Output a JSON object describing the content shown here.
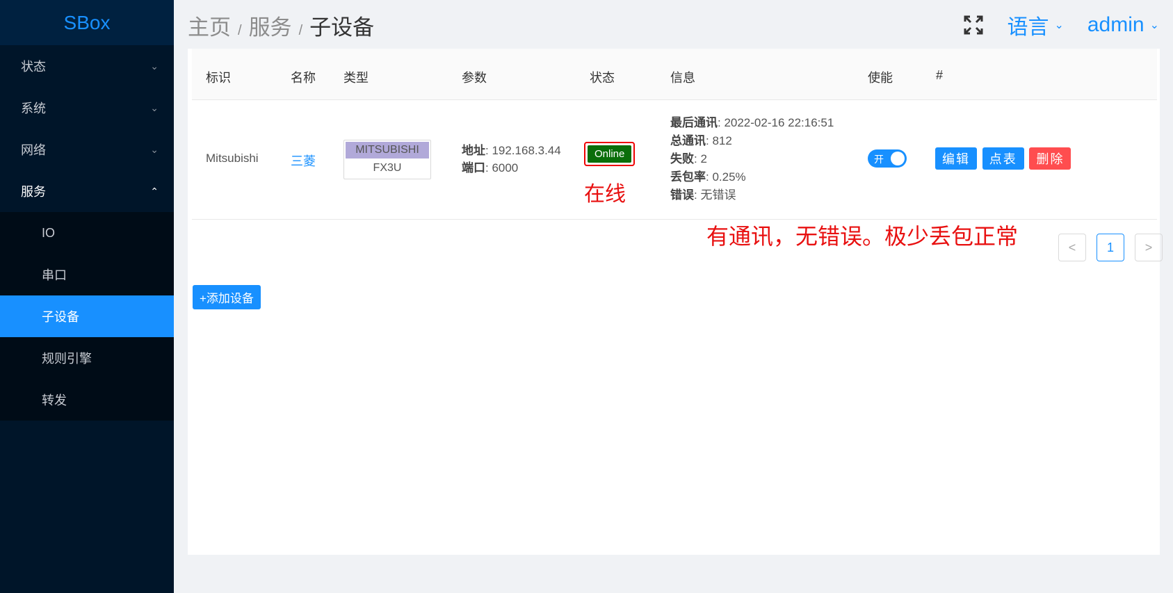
{
  "app": {
    "logo": "SBox"
  },
  "sidebar": {
    "items": [
      {
        "label": "状态"
      },
      {
        "label": "系统"
      },
      {
        "label": "网络"
      },
      {
        "label": "服务"
      }
    ],
    "sub_items": [
      {
        "label": "IO"
      },
      {
        "label": "串口"
      },
      {
        "label": "子设备"
      },
      {
        "label": "规则引擎"
      },
      {
        "label": "转发"
      }
    ],
    "active_item": "子设备"
  },
  "header": {
    "breadcrumb": [
      "主页",
      "服务",
      "子设备"
    ],
    "separator": "/",
    "language_label": "语言",
    "user_label": "admin"
  },
  "table": {
    "columns": [
      "标识",
      "名称",
      "类型",
      "参数",
      "状态",
      "信息",
      "使能",
      "#"
    ],
    "rows": [
      {
        "id": "Mitsubishi",
        "name": "三菱",
        "type_top": "MITSUBISHI",
        "type_bottom": "FX3U",
        "params": [
          {
            "label": "地址",
            "value": ": 192.168.3.44"
          },
          {
            "label": "端口",
            "value": ": 6000"
          }
        ],
        "status": "Online",
        "info": [
          {
            "label": "最后通讯",
            "value": ": 2022-02-16 22:16:51"
          },
          {
            "label": "总通讯",
            "value": ": 812"
          },
          {
            "label": "失败",
            "value": ": 2"
          },
          {
            "label": "丢包率",
            "value": ": 0.25%"
          },
          {
            "label": "错误",
            "value": ": 无错误"
          }
        ],
        "enabled_label": "开",
        "enabled": true,
        "actions": [
          "编辑",
          "点表",
          "删除"
        ]
      }
    ]
  },
  "annotations": {
    "status_note": "在线",
    "info_note": "有通讯，无错误。极少丢包正常"
  },
  "pagination": {
    "prev": "<",
    "current": "1",
    "next": ">"
  },
  "add_button": "+添加设备",
  "colors": {
    "accent": "#1890ff",
    "sidebar_bg": "#001529",
    "online": "#0a6e0a",
    "danger": "#ff4d4f",
    "annotation": "#e81010"
  }
}
